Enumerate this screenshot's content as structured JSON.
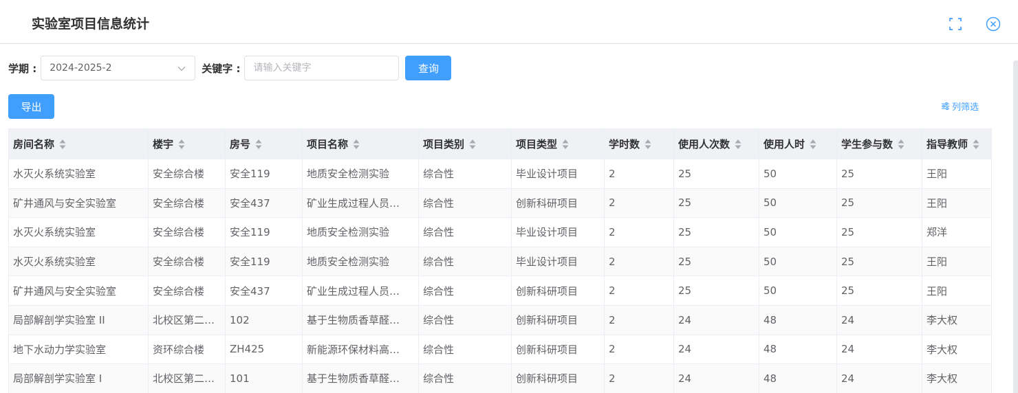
{
  "dialog": {
    "title": "实验室项目信息统计",
    "fullscreen_icon": "fullscreen-icon",
    "close_icon": "close-circle-icon"
  },
  "filters": {
    "semester_label": "学期 :",
    "semester_value": "2024-2025-2",
    "keyword_label": "关键字 :",
    "keyword_value": "",
    "keyword_placeholder": "请输入关键字",
    "query_label": "查询"
  },
  "toolbar": {
    "export_label": "导出",
    "column_filter_label": "列筛选",
    "column_filter_icon": "sliders-icon"
  },
  "colors": {
    "primary": "#409eff",
    "header_bg": "#f0f1f4",
    "border": "#ebeef5"
  },
  "table": {
    "columns": [
      "房间名称",
      "楼宇",
      "房号",
      "项目名称",
      "项目类别",
      "项目类型",
      "学时数",
      "使用人次数",
      "使用人时",
      "学生参与数",
      "指导教师"
    ],
    "rows": [
      [
        "水灭火系统实验室",
        "安全综合楼",
        "安全119",
        "地质安全检测实验",
        "综合性",
        "毕业设计项目",
        "2",
        "25",
        "50",
        "25",
        "王阳"
      ],
      [
        "矿井通风与安全实验室",
        "安全综合楼",
        "安全437",
        "矿业生成过程人员…",
        "综合性",
        "创新科研项目",
        "2",
        "25",
        "50",
        "25",
        "王阳"
      ],
      [
        "水灭火系统实验室",
        "安全综合楼",
        "安全119",
        "地质安全检测实验",
        "综合性",
        "毕业设计项目",
        "2",
        "25",
        "50",
        "25",
        "郑洋"
      ],
      [
        "水灭火系统实验室",
        "安全综合楼",
        "安全119",
        "地质安全检测实验",
        "综合性",
        "毕业设计项目",
        "2",
        "25",
        "50",
        "25",
        "王阳"
      ],
      [
        "矿井通风与安全实验室",
        "安全综合楼",
        "安全437",
        "矿业生成过程人员…",
        "综合性",
        "创新科研项目",
        "2",
        "25",
        "50",
        "25",
        "王阳"
      ],
      [
        "局部解剖学实验室 II",
        "北校区第二…",
        "102",
        "基于生物质香草醛…",
        "综合性",
        "创新科研项目",
        "2",
        "24",
        "48",
        "24",
        "李大权"
      ],
      [
        "地下水动力学实验室",
        "资环综合楼",
        "ZH425",
        "新能源环保材料高…",
        "综合性",
        "创新科研项目",
        "2",
        "24",
        "48",
        "24",
        "李大权"
      ],
      [
        "局部解剖学实验室 I",
        "北校区第二…",
        "101",
        "基于生物质香草醛…",
        "综合性",
        "创新科研项目",
        "2",
        "24",
        "48",
        "24",
        "李大权"
      ]
    ]
  }
}
